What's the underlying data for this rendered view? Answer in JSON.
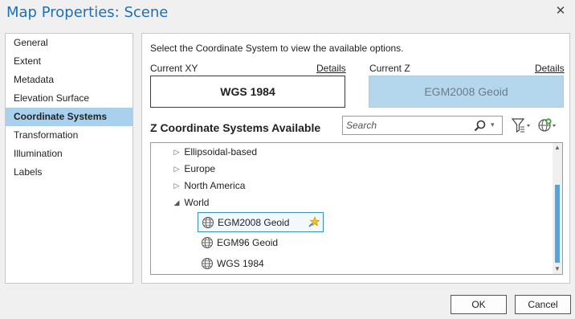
{
  "window": {
    "title": "Map Properties: Scene",
    "close_glyph": "✕"
  },
  "nav": {
    "items": [
      {
        "label": "General",
        "selected": false
      },
      {
        "label": "Extent",
        "selected": false
      },
      {
        "label": "Metadata",
        "selected": false
      },
      {
        "label": "Elevation Surface",
        "selected": false
      },
      {
        "label": "Coordinate Systems",
        "selected": true
      },
      {
        "label": "Transformation",
        "selected": false
      },
      {
        "label": "Illumination",
        "selected": false
      },
      {
        "label": "Labels",
        "selected": false
      }
    ]
  },
  "main": {
    "instruction": "Select the Coordinate System to view the available options.",
    "current_xy": {
      "label": "Current XY",
      "details": "Details",
      "value": "WGS 1984"
    },
    "current_z": {
      "label": "Current Z",
      "details": "Details",
      "value": "EGM2008 Geoid"
    },
    "z_header": "Z Coordinate Systems Available",
    "search": {
      "placeholder": "Search",
      "value": ""
    },
    "tree": {
      "folders": [
        {
          "label": "Ellipsoidal-based",
          "expanded": false
        },
        {
          "label": "Europe",
          "expanded": false
        },
        {
          "label": "North America",
          "expanded": false
        },
        {
          "label": "World",
          "expanded": true
        }
      ],
      "leaves": [
        {
          "label": "EGM2008 Geoid",
          "selected": true,
          "favorite": true
        },
        {
          "label": "EGM96 Geoid",
          "selected": false,
          "favorite": false
        },
        {
          "label": "WGS 1984",
          "selected": false,
          "favorite": false
        }
      ]
    }
  },
  "buttons": {
    "ok": "OK",
    "cancel": "Cancel"
  },
  "icons": {
    "collapsed": "▷",
    "expanded": "◢",
    "scroll_up": "▲",
    "scroll_down": "▼",
    "dropdown": "▾"
  },
  "colors": {
    "accent": "#1f6fb5",
    "selected_bg": "#a9d1ee",
    "current_z_bg": "#b5d7ee",
    "scroll_thumb": "#5aa3d6"
  }
}
